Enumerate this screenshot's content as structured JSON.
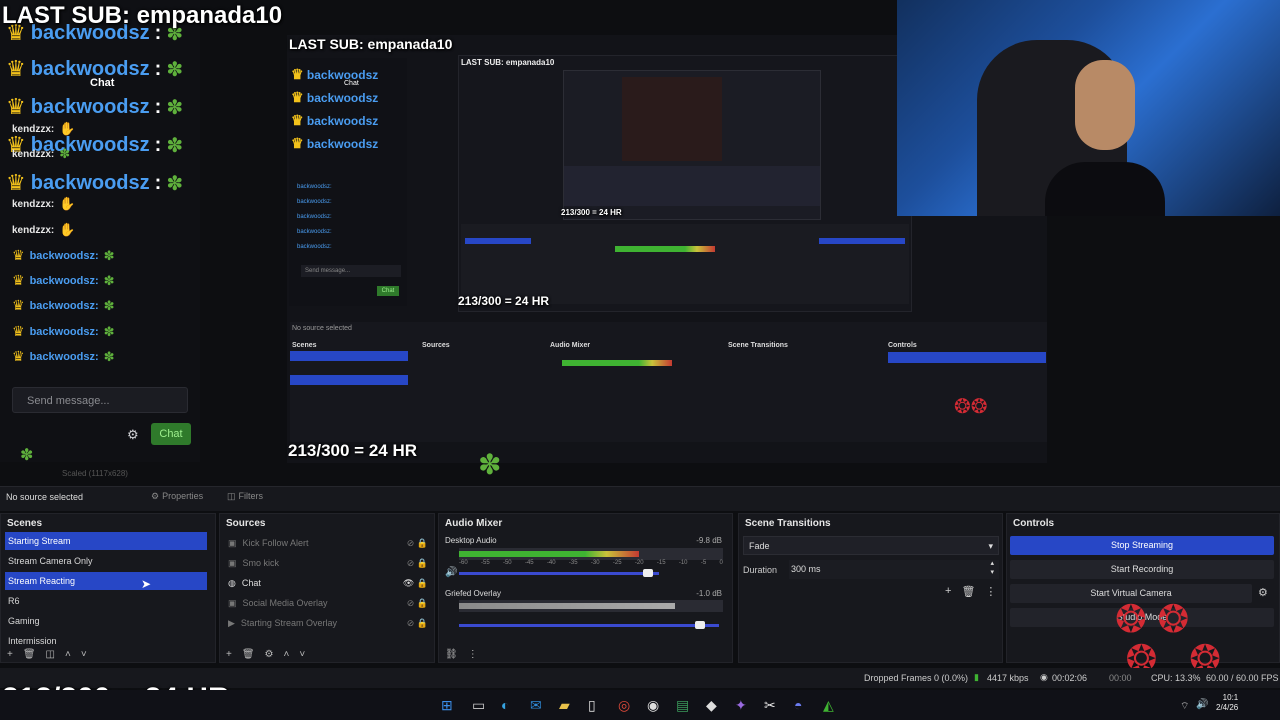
{
  "overlay": {
    "last_sub": "LAST SUB: empanada10",
    "goal": "213/300 = 24 HR"
  },
  "chat": {
    "title": "Chat",
    "big_messages": [
      {
        "user": "backwoodsz",
        "sep": ":"
      },
      {
        "user": "backwoodsz",
        "sep": ":"
      },
      {
        "user": "backwoodsz",
        "sep": ":"
      },
      {
        "user": "backwoodsz",
        "sep": ":"
      },
      {
        "user": "backwoodsz",
        "sep": ":"
      }
    ],
    "small_messages": [
      {
        "user": "kendzzx:"
      },
      {
        "user": "kendzzx:"
      },
      {
        "user": "kendzzx:"
      },
      {
        "user": "kendzzx:"
      },
      {
        "user": "backwoodsz:"
      },
      {
        "user": "backwoodsz:"
      },
      {
        "user": "backwoodsz:"
      },
      {
        "user": "backwoodsz:"
      },
      {
        "user": "backwoodsz:"
      }
    ],
    "placeholder": "Send message...",
    "send_label": "Chat"
  },
  "preview": {
    "scaled_label": "Scaled (1117x628)",
    "nested_last_sub": "LAST SUB: empanada10",
    "nested_goal": "213/300 = 24 HR",
    "nested_chat": "Chat"
  },
  "toolbar": {
    "no_source": "No source selected",
    "properties": "Properties",
    "filters": "Filters"
  },
  "scenes": {
    "title": "Scenes",
    "items": [
      {
        "label": "Starting Stream",
        "selected": true
      },
      {
        "label": "Stream Camera Only",
        "selected": false
      },
      {
        "label": "Stream Reacting",
        "selected": true
      },
      {
        "label": "R6",
        "selected": false
      },
      {
        "label": "Gaming",
        "selected": false
      },
      {
        "label": "Intermission",
        "selected": false
      }
    ]
  },
  "sources": {
    "title": "Sources",
    "items": [
      {
        "label": "Kick Follow Alert",
        "visible": false
      },
      {
        "label": "Smo kick",
        "visible": false
      },
      {
        "label": "Chat",
        "visible": true
      },
      {
        "label": "Social Media Overlay",
        "visible": false
      },
      {
        "label": "Starting Stream Overlay",
        "visible": false
      }
    ]
  },
  "audio_mixer": {
    "title": "Audio Mixer",
    "channels": [
      {
        "name": "Desktop Audio",
        "db": "-9.8 dB",
        "level": 0.68,
        "volume": 0.88
      },
      {
        "name": "Griefed Overlay",
        "db": "-1.0 dB",
        "level": 0.82,
        "volume": 0.95
      }
    ],
    "ticks": [
      "-60",
      "-55",
      "-50",
      "-45",
      "-40",
      "-35",
      "-30",
      "-25",
      "-20",
      "-15",
      "-10",
      "-5",
      "0"
    ]
  },
  "transitions": {
    "title": "Scene Transitions",
    "type": "Fade",
    "duration_label": "Duration",
    "duration_value": "300 ms"
  },
  "controls": {
    "title": "Controls",
    "stop_streaming": "Stop Streaming",
    "start_recording": "Start Recording",
    "start_virtual_camera": "Start Virtual Camera",
    "studio_mode": "Studio Mode"
  },
  "statusbar": {
    "dropped_frames": "Dropped Frames 0 (0.0%)",
    "bitrate": "4417 kbps",
    "live_time": "00:02:06",
    "rec_time": "00:00",
    "cpu": "CPU: 13.3%",
    "fps": "60.00 / 60.00 FPS"
  },
  "taskbar": {
    "time": "10:1",
    "date": "2/4/26"
  },
  "colors": {
    "accent": "#2747c6",
    "username": "#4a9df1",
    "crown": "#f3c21b",
    "chat_button": "#2f7a2b"
  }
}
